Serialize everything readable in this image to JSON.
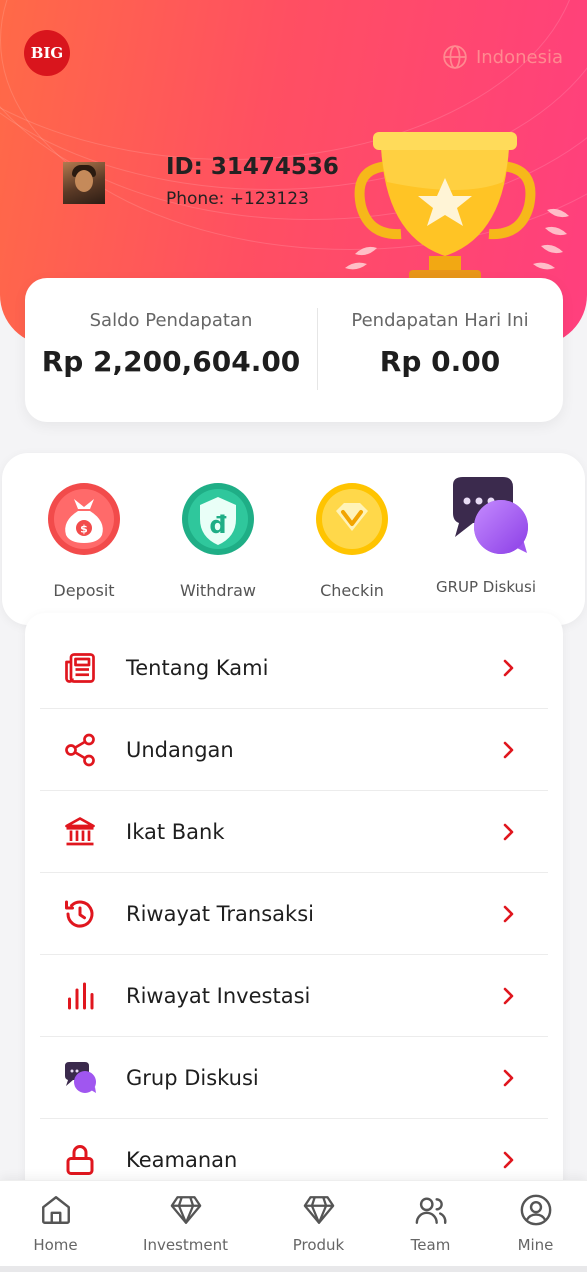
{
  "header": {
    "logo_text": "BIG",
    "language": "Indonesia",
    "user_id": "ID: 31474536",
    "user_phone": "Phone: +123123"
  },
  "balance": {
    "income_label": "Saldo Pendapatan",
    "income_value": "Rp 2,200,604.00",
    "today_label": "Pendapatan Hari Ini",
    "today_value": "Rp 0.00"
  },
  "actions": [
    {
      "label": "Deposit",
      "icon": "money-bag-icon"
    },
    {
      "label": "Withdraw",
      "icon": "shield-dong-icon"
    },
    {
      "label": "Checkin",
      "icon": "diamond-badge-icon"
    },
    {
      "label": "GRUP Diskusi",
      "icon": "chat-bubbles-icon"
    }
  ],
  "menu": [
    {
      "label": "Tentang Kami",
      "icon": "newspaper-icon"
    },
    {
      "label": "Undangan",
      "icon": "share-icon"
    },
    {
      "label": "Ikat Bank",
      "icon": "bank-icon"
    },
    {
      "label": "Riwayat Transaksi",
      "icon": "history-icon"
    },
    {
      "label": "Riwayat Investasi",
      "icon": "bar-chart-icon"
    },
    {
      "label": "Grup Diskusi",
      "icon": "chat-bubbles-icon"
    },
    {
      "label": "Keamanan",
      "icon": "lock-icon"
    }
  ],
  "tabbar": [
    {
      "label": "Home",
      "icon": "home-icon"
    },
    {
      "label": "Investment",
      "icon": "diamond-icon"
    },
    {
      "label": "Produk",
      "icon": "diamond-icon"
    },
    {
      "label": "Team",
      "icon": "team-icon"
    },
    {
      "label": "Mine",
      "icon": "user-circle-icon"
    }
  ],
  "colors": {
    "accent": "#e0161e",
    "hero_start": "#ff6a47",
    "hero_end": "#ff3f7e",
    "text_dark": "#1e1e1e",
    "text_muted": "#666666"
  }
}
